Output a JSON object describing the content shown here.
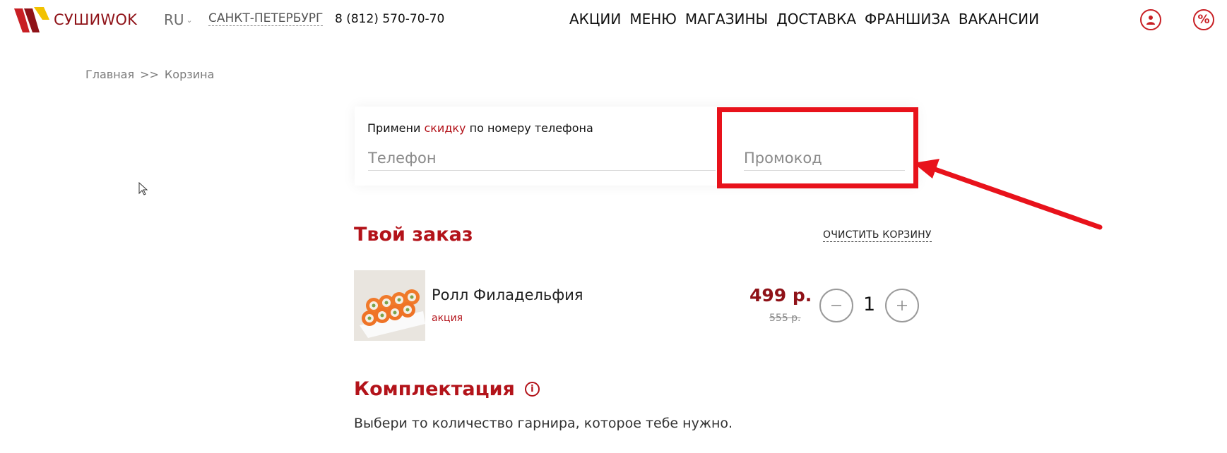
{
  "header": {
    "logo_text": "СУШИWOK",
    "lang": "RU",
    "city": "САНКТ-ПЕТЕРБУРГ",
    "phone": "8 (812) 570-70-70",
    "nav": [
      "АКЦИИ",
      "МЕНЮ",
      "МАГАЗИНЫ",
      "ДОСТАВКА",
      "ФРАНШИЗА",
      "ВАКАНСИИ"
    ],
    "icons": [
      "user-icon",
      "percent-icon"
    ]
  },
  "breadcrumb": {
    "home": "Главная",
    "separator": ">>",
    "current": "Корзина"
  },
  "discount": {
    "text_before": "Примени ",
    "text_accent": "скидку",
    "text_after": " по номеру телефона",
    "phone_placeholder": "Телефон",
    "promo_placeholder": "Промокод"
  },
  "order": {
    "title": "Твой заказ",
    "clear_label": "ОЧИСТИТЬ КОРЗИНУ",
    "items": [
      {
        "name": "Ролл Филадельфия",
        "tag": "акция",
        "price": "499 р.",
        "old_price": "555 р.",
        "quantity": "1"
      }
    ]
  },
  "kit": {
    "title": "Комплектация",
    "description": "Выбери то количество гарнира, которое тебе нужно."
  },
  "colors": {
    "accent": "#b3131a",
    "brand_dark": "#8f1218",
    "highlight": "#e8121b"
  }
}
